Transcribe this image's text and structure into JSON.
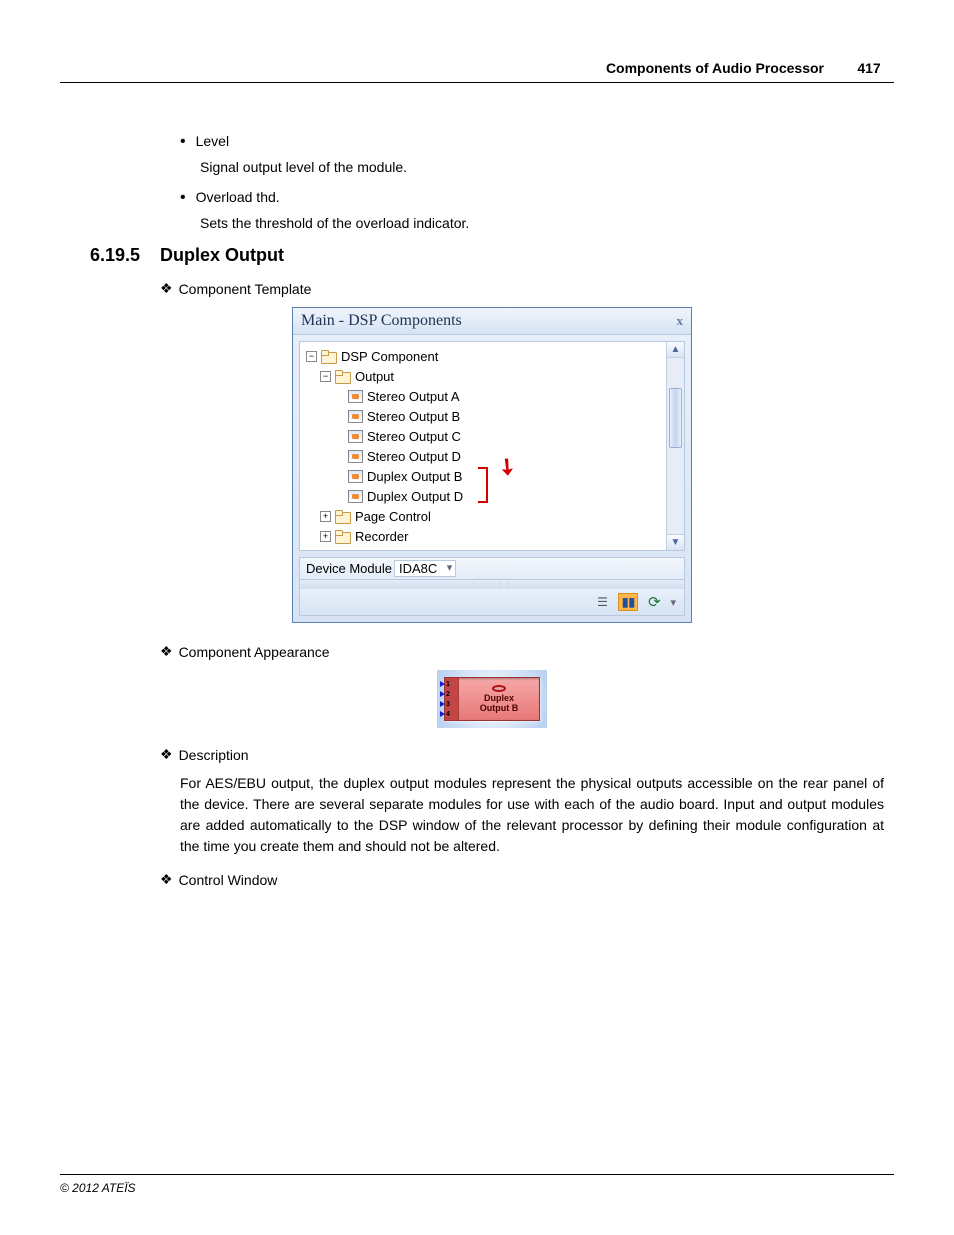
{
  "header": {
    "title": "Components of Audio Processor",
    "page": "417"
  },
  "bullets": [
    {
      "label": "Level",
      "desc": "Signal output level of the module."
    },
    {
      "label": "Overload thd.",
      "desc": "Sets the threshold of the  overload indicator."
    }
  ],
  "section": {
    "number": "6.19.5",
    "title": "Duplex Output"
  },
  "diamonds": {
    "template": "Component Template",
    "appearance": "Component Appearance",
    "description": "Description",
    "control": "Control Window"
  },
  "dsp": {
    "title": "Main - DSP Components",
    "tree": {
      "root": "DSP Component",
      "output": "Output",
      "items": [
        "Stereo Output A",
        "Stereo Output B",
        "Stereo Output C",
        "Stereo Output D",
        "Duplex Output B",
        "Duplex Output D"
      ],
      "page": "Page Control",
      "recorder": "Recorder"
    },
    "deviceLabel": "Device Module",
    "deviceValue": "IDA8C"
  },
  "comp": {
    "line1": "Duplex",
    "line2": "Output B",
    "ports": [
      "1",
      "2",
      "3",
      "4"
    ]
  },
  "desc_body": "For AES/EBU output, the duplex output modules represent the physical outputs accessible on the rear panel of the device. There are several separate modules for use with each of the audio board. Input and output modules are added automatically to the DSP window of the relevant processor by defining their module configuration at the time you create them and should not be altered.",
  "footer": "© 2012 ATEÏS"
}
